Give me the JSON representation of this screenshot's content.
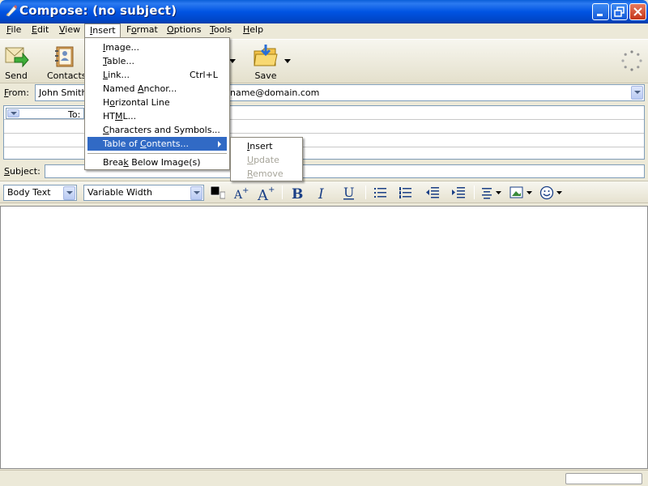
{
  "window": {
    "title": "Compose: (no subject)"
  },
  "menubar": {
    "items": [
      {
        "label": "File",
        "ul": "F",
        "rest": "ile"
      },
      {
        "label": "Edit",
        "ul": "E",
        "rest": "dit"
      },
      {
        "label": "View",
        "ul": "V",
        "rest": "iew"
      },
      {
        "label": "Insert",
        "ul": "I",
        "rest": "nsert"
      },
      {
        "label": "Format",
        "pre": "F",
        "ul": "o",
        "rest": "rmat"
      },
      {
        "label": "Options",
        "ul": "O",
        "rest": "ptions"
      },
      {
        "label": "Tools",
        "ul": "T",
        "rest": "ools"
      },
      {
        "label": "Help",
        "ul": "H",
        "rest": "elp"
      }
    ]
  },
  "toolbar": {
    "send_label": "Send",
    "contacts_label": "Contacts",
    "save_label": "Save"
  },
  "header": {
    "from_label": "From:",
    "from_value": "John Smith",
    "from_email": "name@domain.com",
    "to_label": "To:",
    "subject_label": "Subject:",
    "subject_value": ""
  },
  "format_bar": {
    "paragraph_style": "Body Text",
    "font": "Variable Width",
    "text_color": "#000000"
  },
  "insert_menu": {
    "items": [
      {
        "label": "Image...",
        "ul": "I",
        "rest": "mage..."
      },
      {
        "label": "Table...",
        "ul": "T",
        "rest": "able..."
      },
      {
        "label": "Link...",
        "ul": "L",
        "rest": "ink...",
        "shortcut": "Ctrl+L"
      },
      {
        "label": "Named Anchor...",
        "pre": "Named ",
        "ul": "A",
        "rest": "nchor..."
      },
      {
        "label": "Horizontal Line",
        "pre": "H",
        "ul": "o",
        "rest": "rizontal Line"
      },
      {
        "label": "HTML...",
        "pre": "HT",
        "ul": "M",
        "rest": "L..."
      },
      {
        "label": "Characters and Symbols...",
        "ul": "C",
        "rest": "haracters and Symbols..."
      },
      {
        "label": "Table of Contents...",
        "pre": "Table of ",
        "ul": "C",
        "rest": "ontents..."
      },
      {
        "label": "Break Below Image(s)",
        "pre": "Brea",
        "ul": "k",
        "rest": " Below Image(s)"
      }
    ]
  },
  "toc_submenu": {
    "items": [
      {
        "label": "Insert",
        "ul": "I",
        "rest": "nsert",
        "enabled": true
      },
      {
        "label": "Update",
        "ul": "U",
        "rest": "pdate",
        "enabled": false
      },
      {
        "label": "Remove",
        "ul": "R",
        "rest": "emove",
        "enabled": false
      }
    ]
  },
  "colors": {
    "titlebar": "#0054e3",
    "highlight": "#316ac5",
    "chrome": "#ece9d8"
  }
}
